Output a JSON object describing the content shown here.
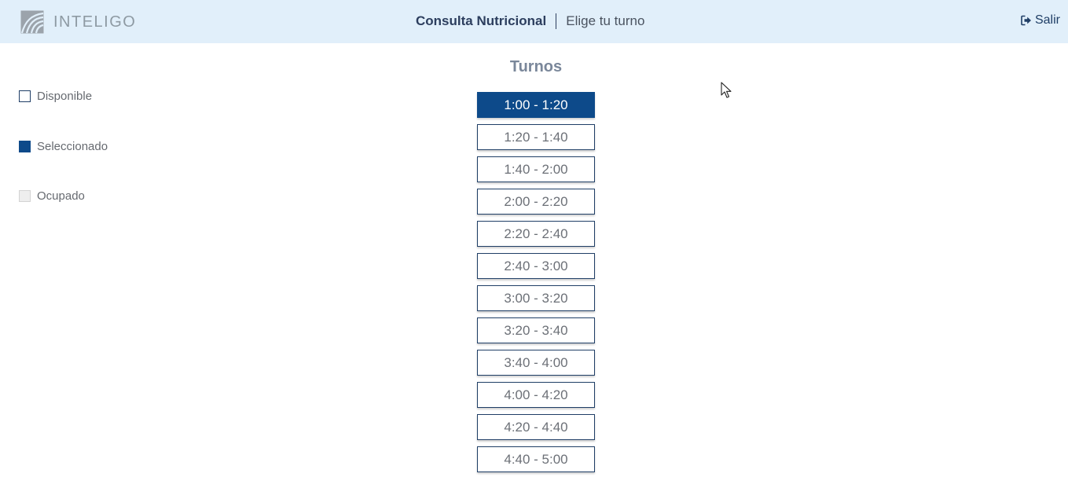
{
  "header": {
    "logo_text": "INTELIGO",
    "title": "Consulta Nutricional",
    "subtitle": "Elige tu turno",
    "logout_label": "Salir",
    "logout_icon": "sign-out-icon",
    "background_color": "#e1effa"
  },
  "legend": {
    "items": [
      {
        "label": "Disponible",
        "state": "available"
      },
      {
        "label": "Seleccionado",
        "state": "selected",
        "color": "#0d4a8a"
      },
      {
        "label": "Ocupado",
        "state": "occupied",
        "color": "#eeeeee"
      }
    ]
  },
  "slots": {
    "title": "Turnos",
    "selected_index": 0,
    "items": [
      "1:00 - 1:20",
      "1:20 - 1:40",
      "1:40 - 2:00",
      "2:00 - 2:20",
      "2:20 - 2:40",
      "2:40 - 3:00",
      "3:00 - 3:20",
      "3:20 - 3:40",
      "3:40 - 4:00",
      "4:00 - 4:20",
      "4:20 - 4:40",
      "4:40 - 5:00"
    ]
  },
  "colors": {
    "accent": "#0d4a8a",
    "border": "#1f3e66"
  }
}
